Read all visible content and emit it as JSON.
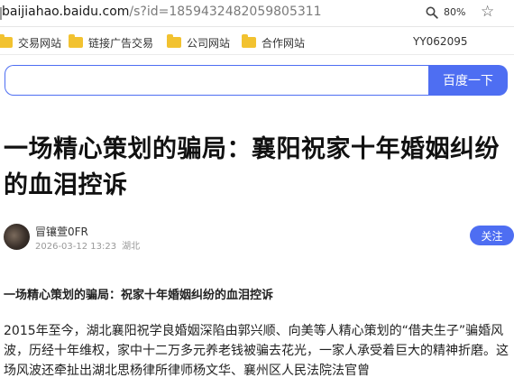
{
  "browser": {
    "url_host": "baijiahao.baidu.com",
    "url_path": "/s?id=1859432482059805311",
    "zoom": "80%",
    "zoom_icon": "magnifier-icon",
    "favorite_icon": "star-outline-icon"
  },
  "bookmarks": {
    "items": [
      {
        "label": "交易网站",
        "icon": "folder-icon"
      },
      {
        "label": "链接广告交易",
        "icon": "folder-icon"
      },
      {
        "label": "公司网站",
        "icon": "folder-icon"
      },
      {
        "label": "合作网站",
        "icon": "folder-icon"
      }
    ],
    "extra": "YY062095"
  },
  "search": {
    "value": "",
    "button_label": "百度一下"
  },
  "article": {
    "title": "一场精心策划的骗局：襄阳祝家十年婚姻纠纷的血泪控诉",
    "author": "冒镶萱0FR",
    "date": "2026-03-12 13:23",
    "location": "湖北",
    "follow_label": "关注",
    "subhead": "一场精心策划的骗局：祝家十年婚姻纠纷的血泪控诉",
    "body": "2015年至今，湖北襄阳祝学良婚姻深陷由郭兴顺、向美等人精心策划的“借夫生子”骗婚风波，历经十年维权，家中十二万多元养老钱被骗去花光，一家人承受着巨大的精神折磨。这场风波还牵扯出湖北思杨律所律师杨文华、襄州区人民法院法官曾"
  },
  "colors": {
    "accent": "#4e6ef2",
    "folder": "#f2c230",
    "meta": "#999999"
  }
}
